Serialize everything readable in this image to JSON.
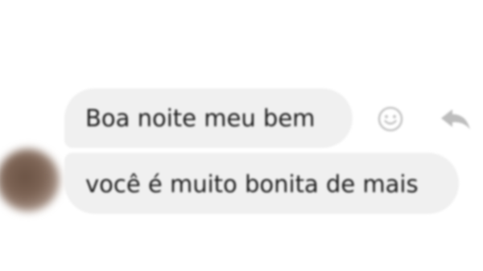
{
  "conversation": {
    "messages": [
      {
        "text": "Boa noite meu bem"
      },
      {
        "text": "você é muito bonita de mais"
      }
    ],
    "actions": {
      "react_icon": "smiley-face-icon",
      "reply_icon": "reply-arrow-icon"
    }
  },
  "colors": {
    "bubble": "#f0f0f0",
    "icon": "#c4c4c4",
    "text": "#1c1c1c"
  }
}
